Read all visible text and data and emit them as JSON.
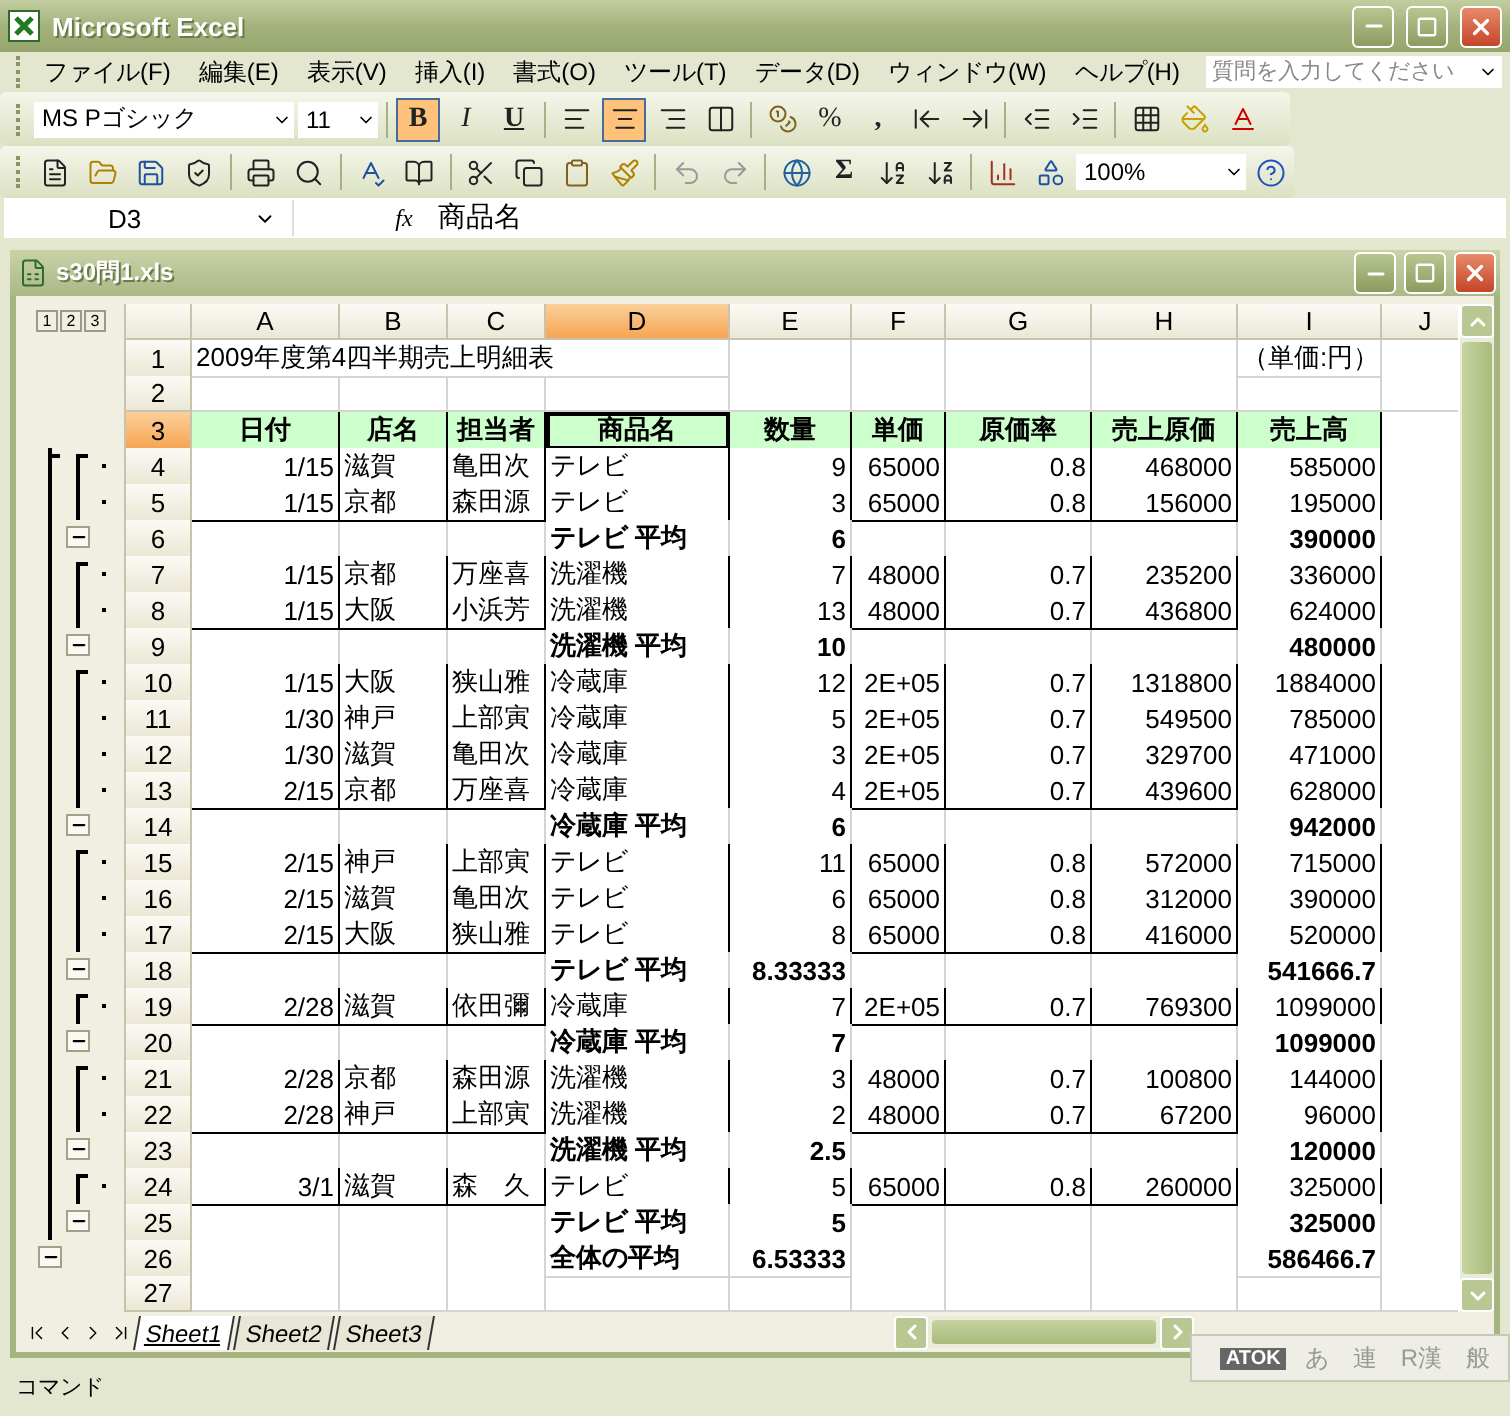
{
  "window": {
    "title": "Microsoft Excel"
  },
  "menu": [
    "ファイル(F)",
    "編集(E)",
    "表示(V)",
    "挿入(I)",
    "書式(O)",
    "ツール(T)",
    "データ(D)",
    "ウィンドウ(W)",
    "ヘルプ(H)"
  ],
  "help_search": {
    "placeholder": "質問を入力してください"
  },
  "format_toolbar": {
    "font": "MS Pゴシック",
    "size": "11",
    "bold": {
      "label": "B",
      "pressed": true
    },
    "italic": {
      "label": "I",
      "pressed": false
    },
    "underline": {
      "label": "U",
      "pressed": false
    },
    "align_buttons": [
      {
        "pressed": false
      },
      {
        "pressed": true
      },
      {
        "pressed": false
      }
    ],
    "percent": "%",
    "comma": ","
  },
  "standard_toolbar": {
    "sum": "Σ",
    "zoom": "100%"
  },
  "formula_bar": {
    "name_box": "D3",
    "fx": "fx",
    "value": "商品名"
  },
  "workbook": {
    "title": "s30問1.xls"
  },
  "outline_levels": [
    "1",
    "2",
    "3"
  ],
  "columns": [
    {
      "label": "A",
      "selected": false
    },
    {
      "label": "B",
      "selected": false
    },
    {
      "label": "C",
      "selected": false
    },
    {
      "label": "D",
      "selected": true
    },
    {
      "label": "E",
      "selected": false
    },
    {
      "label": "F",
      "selected": false
    },
    {
      "label": "G",
      "selected": false
    },
    {
      "label": "H",
      "selected": false
    },
    {
      "label": "I",
      "selected": false
    },
    {
      "label": "J",
      "selected": false
    }
  ],
  "rows": [
    {
      "num": "1",
      "kind": "title",
      "selected": false,
      "cells": {
        "A": "2009年度第4四半期売上明細表",
        "I": "（単価:円）"
      }
    },
    {
      "num": "2",
      "kind": "blank",
      "selected": false,
      "cells": {}
    },
    {
      "num": "3",
      "kind": "header",
      "selected": true,
      "cells": {
        "A": "日付",
        "B": "店名",
        "C": "担当者",
        "D": "商品名",
        "E": "数量",
        "F": "単価",
        "G": "原価率",
        "H": "売上原価",
        "I": "売上高"
      }
    },
    {
      "num": "4",
      "kind": "data",
      "selected": false,
      "cells": {
        "A": "1/15",
        "B": "滋賀",
        "C": "亀田次",
        "D": "テレビ",
        "E": "9",
        "F": "65000",
        "G": "0.8",
        "H": "468000",
        "I": "585000"
      }
    },
    {
      "num": "5",
      "kind": "data",
      "selected": false,
      "cells": {
        "A": "1/15",
        "B": "京都",
        "C": "森田源",
        "D": "テレビ",
        "E": "3",
        "F": "65000",
        "G": "0.8",
        "H": "156000",
        "I": "195000"
      }
    },
    {
      "num": "6",
      "kind": "subtotal",
      "selected": false,
      "cells": {
        "D": "テレビ  平均",
        "E": "6",
        "I": "390000"
      }
    },
    {
      "num": "7",
      "kind": "data",
      "selected": false,
      "cells": {
        "A": "1/15",
        "B": "京都",
        "C": "万座喜",
        "D": "洗濯機",
        "E": "7",
        "F": "48000",
        "G": "0.7",
        "H": "235200",
        "I": "336000"
      }
    },
    {
      "num": "8",
      "kind": "data",
      "selected": false,
      "cells": {
        "A": "1/15",
        "B": "大阪",
        "C": "小浜芳",
        "D": "洗濯機",
        "E": "13",
        "F": "48000",
        "G": "0.7",
        "H": "436800",
        "I": "624000"
      }
    },
    {
      "num": "9",
      "kind": "subtotal",
      "selected": false,
      "cells": {
        "D": "洗濯機  平均",
        "E": "10",
        "I": "480000"
      }
    },
    {
      "num": "10",
      "kind": "data",
      "selected": false,
      "cells": {
        "A": "1/15",
        "B": "大阪",
        "C": "狭山雅",
        "D": "冷蔵庫",
        "E": "12",
        "F": "2E+05",
        "G": "0.7",
        "H": "1318800",
        "I": "1884000"
      }
    },
    {
      "num": "11",
      "kind": "data",
      "selected": false,
      "cells": {
        "A": "1/30",
        "B": "神戸",
        "C": "上部寅",
        "D": "冷蔵庫",
        "E": "5",
        "F": "2E+05",
        "G": "0.7",
        "H": "549500",
        "I": "785000"
      }
    },
    {
      "num": "12",
      "kind": "data",
      "selected": false,
      "cells": {
        "A": "1/30",
        "B": "滋賀",
        "C": "亀田次",
        "D": "冷蔵庫",
        "E": "3",
        "F": "2E+05",
        "G": "0.7",
        "H": "329700",
        "I": "471000"
      }
    },
    {
      "num": "13",
      "kind": "data",
      "selected": false,
      "cells": {
        "A": "2/15",
        "B": "京都",
        "C": "万座喜",
        "D": "冷蔵庫",
        "E": "4",
        "F": "2E+05",
        "G": "0.7",
        "H": "439600",
        "I": "628000"
      }
    },
    {
      "num": "14",
      "kind": "subtotal",
      "selected": false,
      "cells": {
        "D": "冷蔵庫  平均",
        "E": "6",
        "I": "942000"
      }
    },
    {
      "num": "15",
      "kind": "data",
      "selected": false,
      "cells": {
        "A": "2/15",
        "B": "神戸",
        "C": "上部寅",
        "D": "テレビ",
        "E": "11",
        "F": "65000",
        "G": "0.8",
        "H": "572000",
        "I": "715000"
      }
    },
    {
      "num": "16",
      "kind": "data",
      "selected": false,
      "cells": {
        "A": "2/15",
        "B": "滋賀",
        "C": "亀田次",
        "D": "テレビ",
        "E": "6",
        "F": "65000",
        "G": "0.8",
        "H": "312000",
        "I": "390000"
      }
    },
    {
      "num": "17",
      "kind": "data",
      "selected": false,
      "cells": {
        "A": "2/15",
        "B": "大阪",
        "C": "狭山雅",
        "D": "テレビ",
        "E": "8",
        "F": "65000",
        "G": "0.8",
        "H": "416000",
        "I": "520000"
      }
    },
    {
      "num": "18",
      "kind": "subtotal",
      "selected": false,
      "cells": {
        "D": "テレビ  平均",
        "E": "8.33333",
        "I": "541666.7"
      }
    },
    {
      "num": "19",
      "kind": "data",
      "selected": false,
      "cells": {
        "A": "2/28",
        "B": "滋賀",
        "C": "依田彌",
        "D": "冷蔵庫",
        "E": "7",
        "F": "2E+05",
        "G": "0.7",
        "H": "769300",
        "I": "1099000"
      }
    },
    {
      "num": "20",
      "kind": "subtotal",
      "selected": false,
      "cells": {
        "D": "冷蔵庫  平均",
        "E": "7",
        "I": "1099000"
      }
    },
    {
      "num": "21",
      "kind": "data",
      "selected": false,
      "cells": {
        "A": "2/28",
        "B": "京都",
        "C": "森田源",
        "D": "洗濯機",
        "E": "3",
        "F": "48000",
        "G": "0.7",
        "H": "100800",
        "I": "144000"
      }
    },
    {
      "num": "22",
      "kind": "data",
      "selected": false,
      "cells": {
        "A": "2/28",
        "B": "神戸",
        "C": "上部寅",
        "D": "洗濯機",
        "E": "2",
        "F": "48000",
        "G": "0.7",
        "H": "67200",
        "I": "96000"
      }
    },
    {
      "num": "23",
      "kind": "subtotal",
      "selected": false,
      "cells": {
        "D": "洗濯機  平均",
        "E": "2.5",
        "I": "120000"
      }
    },
    {
      "num": "24",
      "kind": "data",
      "selected": false,
      "cells": {
        "A": "3/1",
        "B": "滋賀",
        "C": "森　久",
        "D": "テレビ",
        "E": "5",
        "F": "65000",
        "G": "0.8",
        "H": "260000",
        "I": "325000"
      }
    },
    {
      "num": "25",
      "kind": "subtotal",
      "selected": false,
      "cells": {
        "D": "テレビ  平均",
        "E": "5",
        "I": "325000"
      }
    },
    {
      "num": "26",
      "kind": "grand",
      "selected": false,
      "cells": {
        "D": "全体の平均",
        "E": "6.53333",
        "I": "586466.7"
      }
    },
    {
      "num": "27",
      "kind": "blank",
      "selected": false,
      "cells": {}
    }
  ],
  "sheet_tabs": [
    {
      "label": "Sheet1",
      "selected": true
    },
    {
      "label": "Sheet2",
      "selected": false
    },
    {
      "label": "Sheet3",
      "selected": false
    }
  ],
  "ime_bar": [
    "ATOK",
    "あ",
    "連",
    "R漢",
    "般"
  ],
  "status_bar": {
    "text": "コマンド"
  }
}
